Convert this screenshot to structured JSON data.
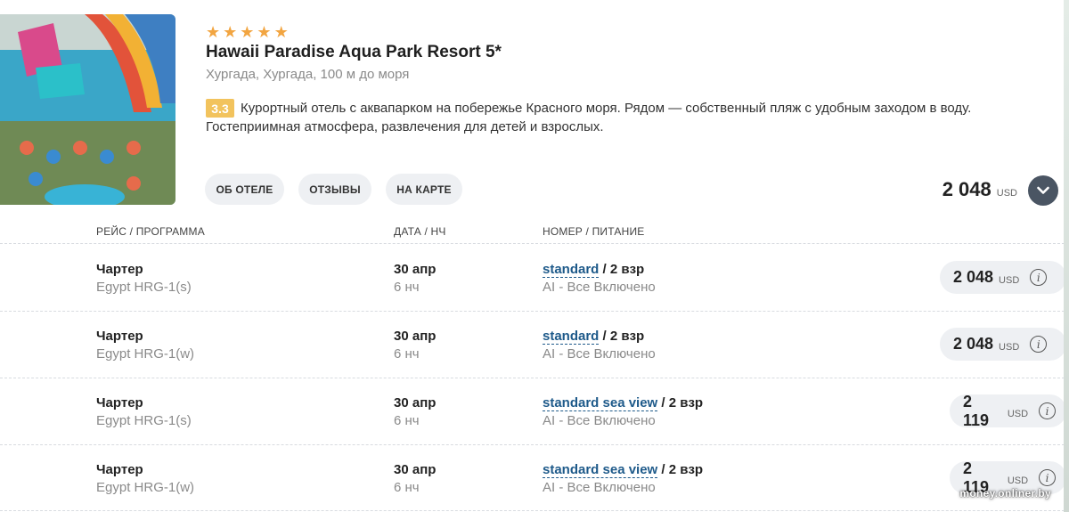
{
  "hotel": {
    "stars": [
      "★",
      "★",
      "★",
      "★",
      "★"
    ],
    "name": "Hawaii Paradise Aqua Park Resort 5*",
    "location": "Хургада, Хургада, 100 м до моря",
    "rating": "3.3",
    "description": "Курортный отель с аквапарком на побережье Красного моря. Рядом — собственный пляж с удобным заходом в воду. Гостеприимная атмосфера, развлечения для детей и взрослых."
  },
  "tabs": {
    "about": "ОБ ОТЕЛЕ",
    "reviews": "ОТЗЫВЫ",
    "map": "НА КАРТЕ"
  },
  "summary_price": {
    "amount": "2 048",
    "currency": "USD"
  },
  "table": {
    "headers": {
      "flight": "РЕЙС / ПРОГРАММА",
      "date": "ДАТА / НЧ",
      "room": "НОМЕР / ПИТАНИЕ"
    },
    "rows": [
      {
        "flight_type": "Чартер",
        "route": "Egypt HRG-1(s)",
        "date": "30 апр",
        "nights": "6 нч",
        "room": "standard",
        "guests": "/ 2 взр",
        "meal": "AI - Все Включено",
        "price": "2 048",
        "currency": "USD"
      },
      {
        "flight_type": "Чартер",
        "route": "Egypt HRG-1(w)",
        "date": "30 апр",
        "nights": "6 нч",
        "room": "standard",
        "guests": "/ 2 взр",
        "meal": "AI - Все Включено",
        "price": "2 048",
        "currency": "USD"
      },
      {
        "flight_type": "Чартер",
        "route": "Egypt HRG-1(s)",
        "date": "30 апр",
        "nights": "6 нч",
        "room": "standard sea view",
        "guests": "/ 2 взр",
        "meal": "AI - Все Включено",
        "price": "2 119",
        "currency": "USD"
      },
      {
        "flight_type": "Чартер",
        "route": "Egypt HRG-1(w)",
        "date": "30 апр",
        "nights": "6 нч",
        "room": "standard sea view",
        "guests": "/ 2 взр",
        "meal": "AI - Все Включено",
        "price": "2 119",
        "currency": "USD"
      }
    ]
  },
  "watermark": "money.onliner.by",
  "colors": {
    "star": "#f2a541",
    "rating_badge": "#f2c35d",
    "room_link": "#1e5a8a",
    "expand_button": "#4a5563",
    "pill_bg": "#eef0f3"
  }
}
